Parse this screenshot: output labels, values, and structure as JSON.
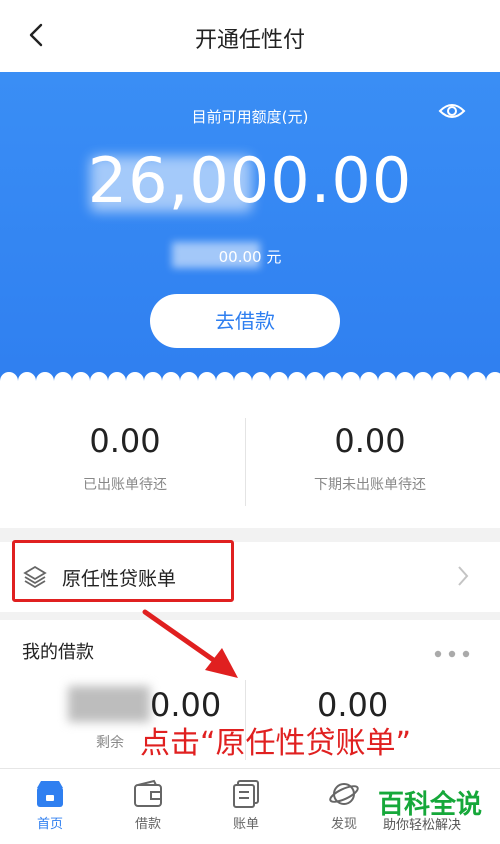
{
  "header": {
    "title": "开通任性付"
  },
  "hero": {
    "label": "目前可用额度(元)",
    "amount": "26,000.00",
    "sub_amount": "00.00 元",
    "borrow_button": "去借款"
  },
  "stats": [
    {
      "value": "0.00",
      "label": "已出账单待还"
    },
    {
      "value": "0.00",
      "label": "下期未出账单待还"
    }
  ],
  "bill_row": {
    "label": "原任性贷账单"
  },
  "loans": {
    "title": "我的借款",
    "items": [
      {
        "value": "0.00",
        "label": "剩余"
      },
      {
        "value": "0.00",
        "label": ""
      }
    ]
  },
  "annotation": {
    "text": "点击“原任性贷账单”"
  },
  "tabbar": {
    "items": [
      {
        "label": "首页",
        "icon": "shop-icon",
        "active": true
      },
      {
        "label": "借款",
        "icon": "wallet-icon",
        "active": false
      },
      {
        "label": "账单",
        "icon": "bill-icon",
        "active": false
      },
      {
        "label": "发现",
        "icon": "planet-icon",
        "active": false
      }
    ]
  },
  "watermark": {
    "title": "百科全说",
    "subtitle": "助你轻松解决"
  },
  "colors": {
    "primary": "#2f7ff0",
    "highlight": "#e02020",
    "watermark": "#16a83a"
  }
}
